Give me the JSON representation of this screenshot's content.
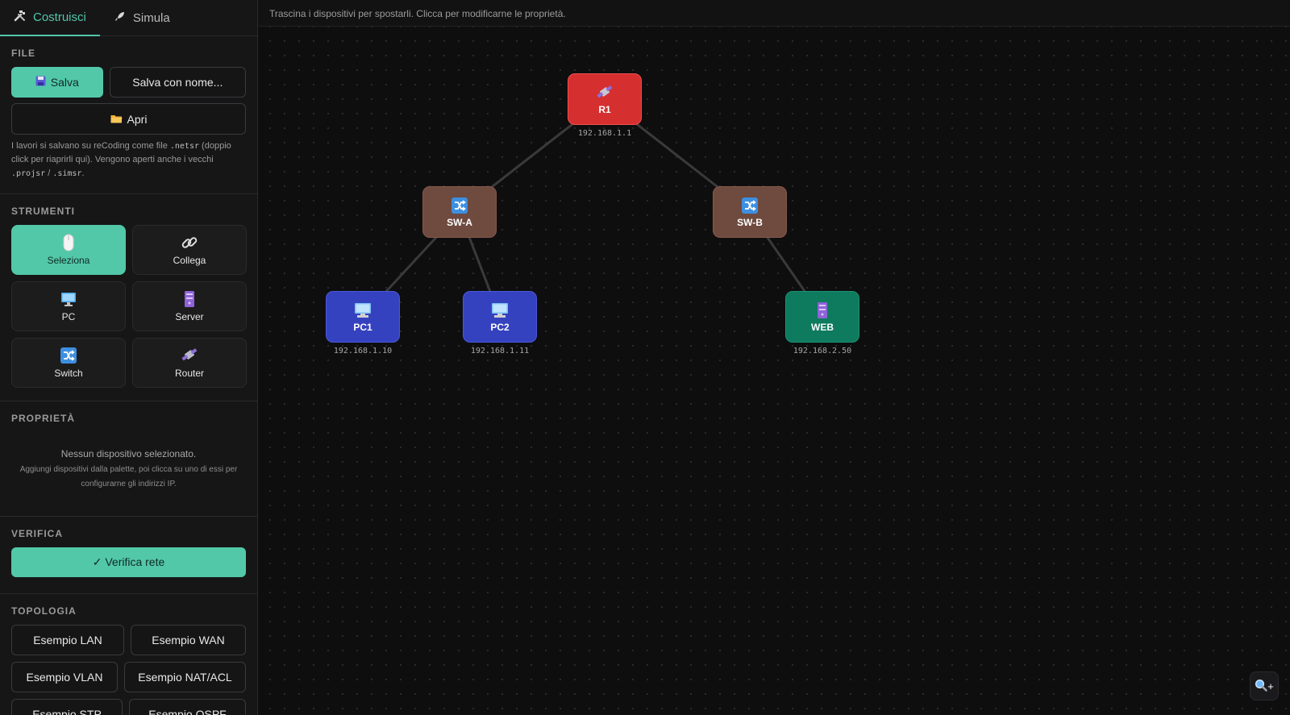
{
  "tabs": [
    {
      "label": "Costruisci",
      "icon": "hammer-wrench-icon",
      "active": true
    },
    {
      "label": "Simula",
      "icon": "rocket-icon",
      "active": false
    }
  ],
  "file": {
    "title": "FILE",
    "save_label": "Salva",
    "save_as_label": "Salva con nome...",
    "open_label": "Apri",
    "note_text_1": "I lavori si salvano su reCoding come file ",
    "note_ext_1": ".netsr",
    "note_text_2": " (doppio click per riaprirli qui). Vengono aperti anche i vecchi ",
    "note_ext_2": ".projsr",
    "note_sep": " / ",
    "note_ext_3": ".simsr",
    "note_text_3": "."
  },
  "tools": {
    "title": "STRUMENTI",
    "items": [
      {
        "label": "Seleziona",
        "icon": "mouse-icon",
        "active": true
      },
      {
        "label": "Collega",
        "icon": "link-icon",
        "active": false
      },
      {
        "label": "PC",
        "icon": "desktop-icon",
        "active": false
      },
      {
        "label": "Server",
        "icon": "server-icon",
        "active": false
      },
      {
        "label": "Switch",
        "icon": "switch-icon",
        "active": false
      },
      {
        "label": "Router",
        "icon": "router-icon",
        "active": false
      }
    ]
  },
  "properties": {
    "title": "PROPRIETÀ",
    "empty_title": "Nessun dispositivo selezionato.",
    "empty_hint": "Aggiungi dispositivi dalla palette, poi clicca su uno di essi per configurarne gli indirizzi IP."
  },
  "verify": {
    "title": "VERIFICA",
    "button_label": "✓ Verifica rete"
  },
  "topology": {
    "title": "TOPOLOGIA",
    "examples": [
      "Esempio LAN",
      "Esempio WAN",
      "Esempio VLAN",
      "Esempio NAT/ACL",
      "Esempio STP",
      "Esempio OSPF"
    ]
  },
  "canvas": {
    "hint": "Trascina i dispositivi per spostarli. Clicca per modificarne le proprietà.",
    "zoom_label": "+",
    "nodes": [
      {
        "id": "R1",
        "label": "R1",
        "type": "router",
        "ip": "192.168.1.1",
        "color": "#d52f2f"
      },
      {
        "id": "SWA",
        "label": "SW-A",
        "type": "switch",
        "ip": "",
        "color": "#6e4a3f"
      },
      {
        "id": "SWB",
        "label": "SW-B",
        "type": "switch",
        "ip": "",
        "color": "#6e4a3f"
      },
      {
        "id": "PC1",
        "label": "PC1",
        "type": "pc",
        "ip": "192.168.1.10",
        "color": "#3542bf"
      },
      {
        "id": "PC2",
        "label": "PC2",
        "type": "pc",
        "ip": "192.168.1.11",
        "color": "#3542bf"
      },
      {
        "id": "WEB",
        "label": "WEB",
        "type": "server",
        "ip": "192.168.2.50",
        "color": "#0e7a5e"
      }
    ],
    "links": [
      [
        "R1",
        "SWA"
      ],
      [
        "R1",
        "SWB"
      ],
      [
        "SWA",
        "PC1"
      ],
      [
        "SWA",
        "PC2"
      ],
      [
        "SWB",
        "WEB"
      ]
    ]
  },
  "colors": {
    "accent": "#52c8a9",
    "router": "#d52f2f",
    "switch": "#6e4a3f",
    "pc": "#3542bf",
    "server": "#0e7a5e"
  }
}
